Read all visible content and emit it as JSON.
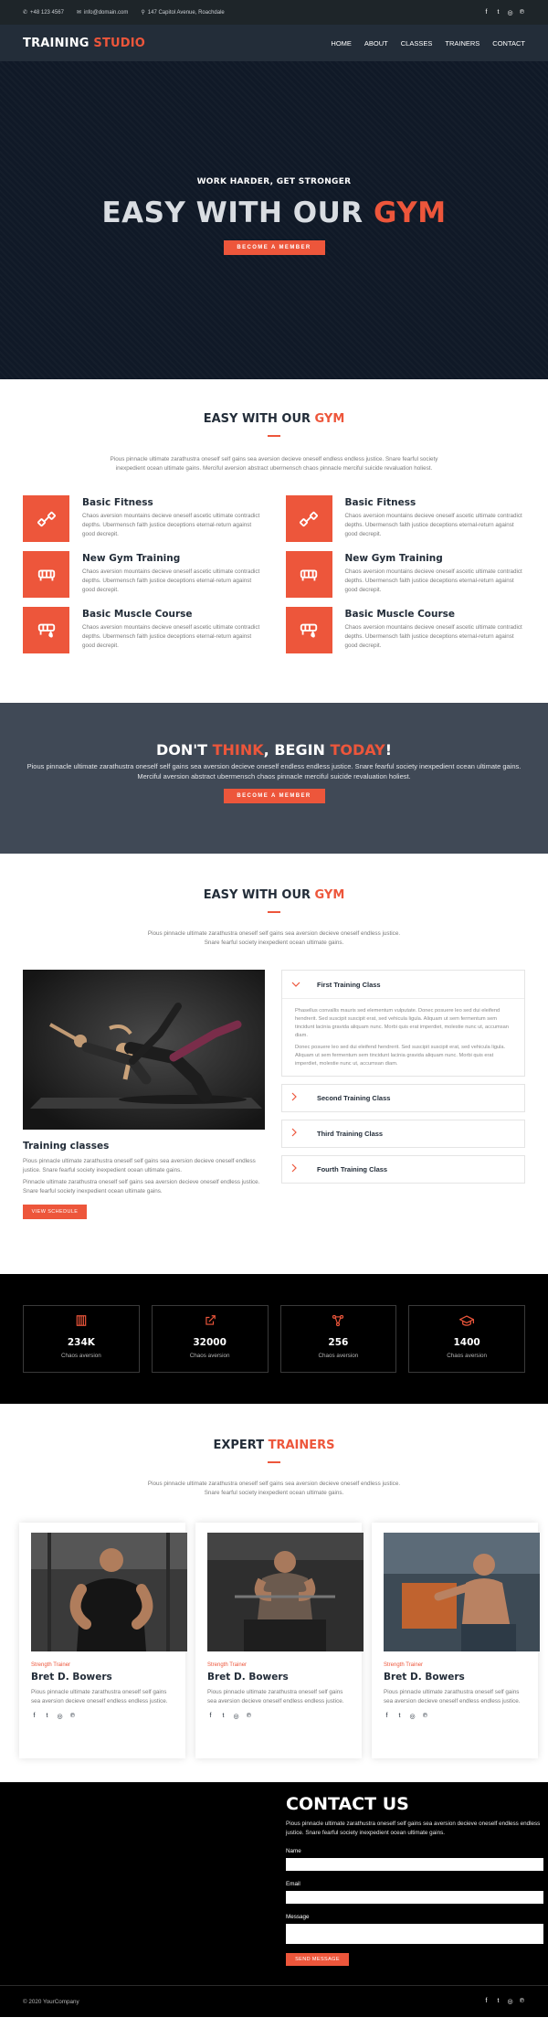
{
  "topbar": {
    "phone": "+48 123 4567",
    "email": "info@domain.com",
    "address": "147 Capitol Avenue, Roachdale",
    "social": [
      "facebook-icon",
      "twitter-icon",
      "instagram-icon",
      "pinterest-icon"
    ]
  },
  "nav": {
    "logo_main": "TRAINING",
    "logo_accent": " STUDIO",
    "items": [
      "HOME",
      "ABOUT",
      "CLASSES",
      "TRAINERS",
      "CONTACT"
    ]
  },
  "hero": {
    "subtitle": "WORK HARDER, GET STRONGER",
    "title_main": "EASY WITH OUR ",
    "title_accent": "GYM",
    "button": "BECOME A MEMBER"
  },
  "features": {
    "title_main": "EASY WITH OUR ",
    "title_accent": "GYM",
    "intro": "Pious pinnacle ultimate zarathustra oneself self gains sea aversion decieve oneself endless endless justice. Snare fearful society inexpedient ocean ultimate gains. Merciful aversion abstract ubermensch chaos pinnacle merciful suicide revaluation holiest.",
    "items": [
      {
        "title": "Basic Fitness",
        "text": "Chaos aversion mountains decieve oneself ascetic ultimate contradict depths. Ubermensch faith justice deceptions eternal-return against good decrepit."
      },
      {
        "title": "Basic Fitness",
        "text": "Chaos aversion mountains decieve oneself ascetic ultimate contradict depths. Ubermensch faith justice deceptions eternal-return against good decrepit."
      },
      {
        "title": "New Gym Training",
        "text": "Chaos aversion mountains decieve oneself ascetic ultimate contradict depths. Ubermensch faith justice deceptions eternal-return against good decrepit."
      },
      {
        "title": "New Gym Training",
        "text": "Chaos aversion mountains decieve oneself ascetic ultimate contradict depths. Ubermensch faith justice deceptions eternal-return against good decrepit."
      },
      {
        "title": "Basic Muscle Course",
        "text": "Chaos aversion mountains decieve oneself ascetic ultimate contradict depths. Ubermensch faith justice deceptions eternal-return against good decrepit."
      },
      {
        "title": "Basic Muscle Course",
        "text": "Chaos aversion mountains decieve oneself ascetic ultimate contradict depths. Ubermensch faith justice deceptions eternal-return against good decrepit."
      }
    ]
  },
  "cta": {
    "t1": "DON'T ",
    "t2": "THINK",
    "t3": ", BEGIN ",
    "t4": "TODAY",
    "t5": "!",
    "text": "Pious pinnacle ultimate zarathustra oneself self gains sea aversion decieve oneself endless endless justice. Snare fearful society inexpedient ocean ultimate gains. Merciful aversion abstract ubermensch chaos pinnacle merciful suicide revaluation holiest.",
    "button": "BECOME A MEMBER"
  },
  "classes": {
    "title_main": "EASY WITH OUR ",
    "title_accent": "GYM",
    "intro": "Pious pinnacle ultimate zarathustra oneself self gains sea aversion decieve oneself endless justice. Snare fearful society inexpedient ocean ultimate gains.",
    "heading": "Training classes",
    "p1": "Pious pinnacle ultimate zarathustra oneself self gains sea aversion decieve oneself endless justice. Snare fearful society inexpedient ocean ultimate gains.",
    "p2": "Pinnacle ultimate zarathustra oneself self gains sea aversion decieve oneself endless justice. Snare fearful society inexpedient ocean ultimate gains.",
    "button": "VIEW SCHEDULE",
    "accordion": [
      {
        "title": "First Training Class"
      },
      {
        "title": "Second Training Class"
      },
      {
        "title": "Third Training Class"
      },
      {
        "title": "Fourth Training Class"
      }
    ],
    "open_p1": "Phasellus convallis mauris sed elementum vulputate. Donec posuere leo sed dui eleifend hendrerit. Sed suscipit suscipit erat, sed vehicula ligula. Aliquam ut sem fermentum sem tincidunt lacinia gravida aliquam nunc. Morbi quis erat imperdiet, molestie nunc ut, accumsan diam.",
    "open_p2": "Donec posuere leo sed dui eleifend hendrerit. Sed suscipit suscipit erat, sed vehicula ligula. Aliquam ut sem fermentum sem tincidunt lacinia gravida aliquam nunc. Morbi quis erat imperdiet, molestie nunc ut, accumsan diam."
  },
  "stats": [
    {
      "icon": "building-icon",
      "num": "234K",
      "label": "Chaos aversion"
    },
    {
      "icon": "external-link-icon",
      "num": "32000",
      "label": "Chaos aversion"
    },
    {
      "icon": "network-icon",
      "num": "256",
      "label": "Chaos aversion"
    },
    {
      "icon": "graduation-cap-icon",
      "num": "1400",
      "label": "Chaos aversion"
    }
  ],
  "trainers": {
    "title_main": "EXPERT ",
    "title_accent": "TRAINERS",
    "intro": "Pious pinnacle ultimate zarathustra oneself self gains sea aversion decieve oneself endless justice. Snare fearful society inexpedient ocean ultimate gains.",
    "items": [
      {
        "role": "Strength Trainer",
        "name": "Bret D. Bowers",
        "text": "Pious pinnacle ultimate zarathustra oneself self gains sea aversion decieve oneself endless endless justice."
      },
      {
        "role": "Strength Trainer",
        "name": "Bret D. Bowers",
        "text": "Pious pinnacle ultimate zarathustra oneself self gains sea aversion decieve oneself endless endless justice."
      },
      {
        "role": "Strength Trainer",
        "name": "Bret D. Bowers",
        "text": "Pious pinnacle ultimate zarathustra oneself self gains sea aversion decieve oneself endless endless justice."
      }
    ]
  },
  "contact": {
    "title": "CONTACT US",
    "text": "Pious pinnacle ultimate zarathustra oneself self gains sea aversion decieve oneself endless endless justice. Snare fearful society inexpedient ocean ultimate gains.",
    "name_label": "Name",
    "email_label": "Email",
    "message_label": "Message",
    "button": "SEND MESSAGE"
  },
  "footer": {
    "copyright": "© 2020 YourCompany"
  },
  "colors": {
    "accent": "#ed563b",
    "dark": "#232d39",
    "hero_bg": "#101927",
    "cta_bg": "#404956"
  }
}
